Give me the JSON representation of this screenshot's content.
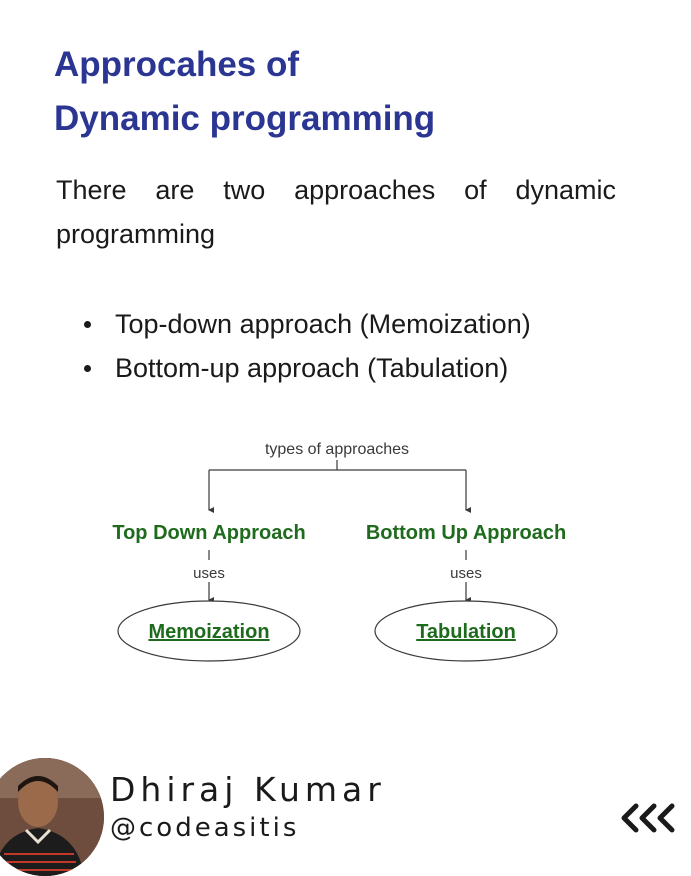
{
  "title": {
    "line1": "Approcahes of",
    "line2": "Dynamic programming"
  },
  "intro": "There are two approaches of dynamic programming",
  "bullets": [
    "Top-down approach (Memoization)",
    "Bottom-up approach (Tabulation)"
  ],
  "diagram": {
    "root": "types of approaches",
    "left": {
      "title": "Top Down Approach",
      "edge_label": "uses",
      "node": "Memoization"
    },
    "right": {
      "title": "Bottom Up Approach",
      "edge_label": "uses",
      "node": "Tabulation"
    }
  },
  "author": {
    "name": "Dhiraj Kumar",
    "handle": "@codeasitis"
  },
  "icons": {
    "nav": "chevrons-left-icon",
    "avatar": "author-photo"
  },
  "colors": {
    "title": "#2b3592",
    "diagram_green": "#1e6b1e",
    "diagram_text": "#3a3a3a"
  }
}
